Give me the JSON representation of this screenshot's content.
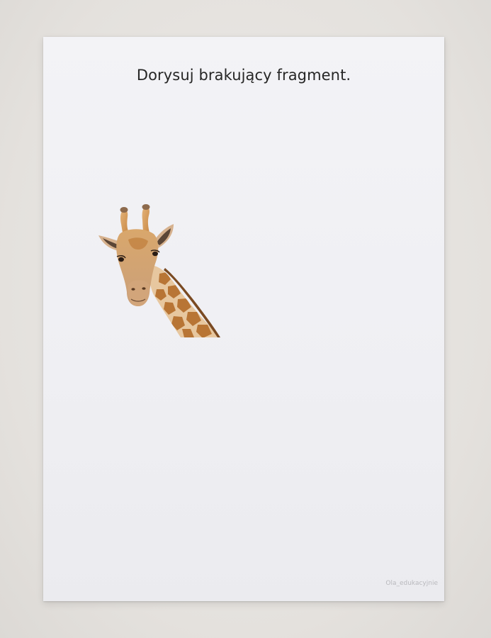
{
  "worksheet": {
    "instruction": "Dorysuj brakujący fragment.",
    "credit": "Ola_edukacyjnie"
  },
  "colors": {
    "background": "#e6e3df",
    "paper": "#f1f1f4",
    "text": "#262626",
    "giraffe_base": "#d49a5a",
    "giraffe_patch": "#b87535"
  },
  "image": {
    "subject": "giraffe-head-icon"
  }
}
